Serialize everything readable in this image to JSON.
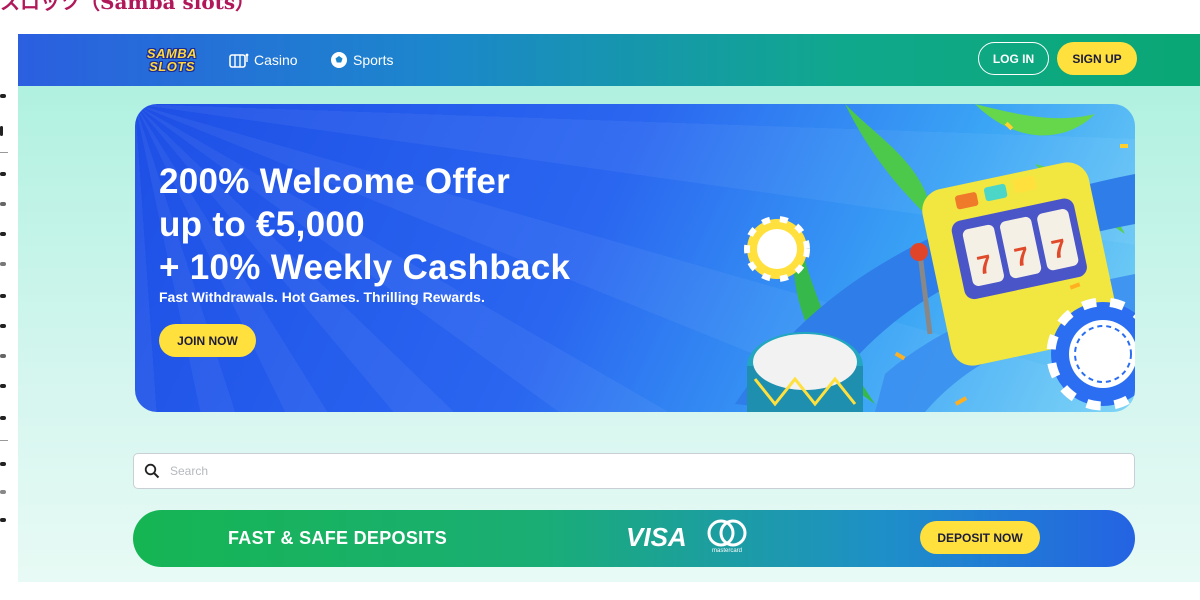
{
  "page_caption": "スロッツ（Samba slots）",
  "header": {
    "logo_lines": [
      "SAMBA",
      "SLOTS"
    ],
    "nav": [
      {
        "label": "Casino",
        "icon": "slot-machine-icon"
      },
      {
        "label": "Sports",
        "icon": "soccer-ball-icon"
      }
    ],
    "login_label": "LOG IN",
    "signup_label": "SIGN UP"
  },
  "hero": {
    "title_lines": [
      "200% Welcome Offer",
      "up to €5,000",
      "+ 10% Weekly Cashback"
    ],
    "subtitle": "Fast Withdrawals. Hot Games. Thrilling Rewards.",
    "cta_label": "JOIN NOW",
    "art_icons": [
      "slot-machine-illustration",
      "drum-illustration",
      "casino-chip-illustration",
      "palm-leaf-illustration"
    ]
  },
  "search": {
    "placeholder": "Search",
    "value": ""
  },
  "deposit": {
    "title": "FAST & SAFE DEPOSITS",
    "visa_label": "VISA",
    "mastercard_label": "mastercard",
    "cta_label": "DEPOSIT NOW"
  },
  "colors": {
    "accent_yellow": "#ffe03d",
    "hero_blue": "#2a66f0",
    "deposit_green": "#16b553",
    "caption_magenta": "#b0185a"
  }
}
